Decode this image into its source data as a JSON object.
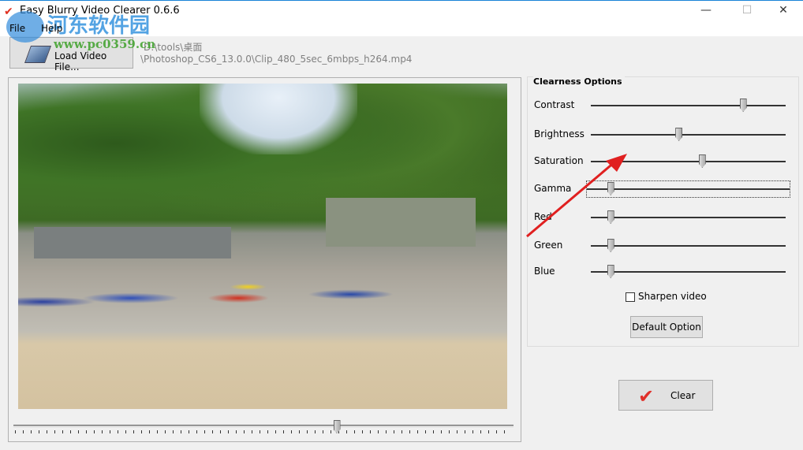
{
  "window": {
    "title": "Easy Blurry Video Clearer 0.6.6",
    "minimize": "—",
    "maximize": "☐",
    "close": "✕"
  },
  "menu": [
    {
      "label": "File"
    },
    {
      "label": "Help"
    }
  ],
  "toolbar": {
    "load_label": "Load Video File...",
    "path_line1": "D:\\tools\\桌面",
    "path_line2": "\\Photoshop_CS6_13.0.0\\Clip_480_5sec_6mbps_h264.mp4"
  },
  "video": {
    "seek_position": 0.65
  },
  "options": {
    "title": "Clearness Options",
    "sliders": [
      {
        "label": "Contrast",
        "value": 0.78
      },
      {
        "label": "Brightness",
        "value": 0.45
      },
      {
        "label": "Saturation",
        "value": 0.57
      },
      {
        "label": "Gamma",
        "value": 0.1,
        "focused": true
      },
      {
        "label": "Red",
        "value": 0.1
      },
      {
        "label": "Green",
        "value": 0.1
      },
      {
        "label": "Blue",
        "value": 0.1
      }
    ],
    "sharpen_label": "Sharpen video",
    "sharpen_checked": false,
    "default_label": "Default Option"
  },
  "clear_label": "Clear",
  "watermark": {
    "text": "河东软件园",
    "url": "www.pc0359.cn"
  },
  "colors": {
    "accent": "#e0302a",
    "annotation_arrow": "#e02020"
  }
}
